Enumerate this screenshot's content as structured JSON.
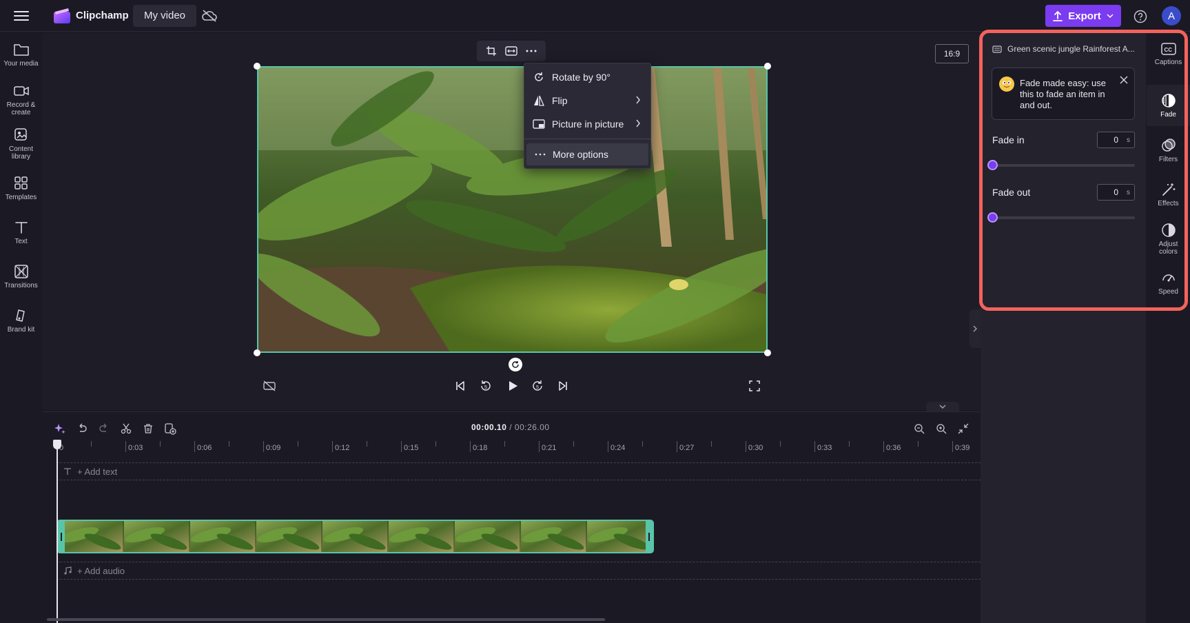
{
  "topbar": {
    "app_name": "Clipchamp",
    "project_title": "My video",
    "export_label": "Export",
    "avatar_initial": "A"
  },
  "sidebar": {
    "items": [
      {
        "label": "Your media",
        "icon": "folder-icon"
      },
      {
        "label": "Record &\ncreate",
        "icon": "camera-icon"
      },
      {
        "label": "Content\nlibrary",
        "icon": "library-icon"
      },
      {
        "label": "Templates",
        "icon": "templates-icon"
      },
      {
        "label": "Text",
        "icon": "text-icon"
      },
      {
        "label": "Transitions",
        "icon": "transitions-icon"
      },
      {
        "label": "Brand kit",
        "icon": "brand-kit-icon"
      }
    ]
  },
  "stage": {
    "aspect_ratio": "16:9"
  },
  "context_menu": {
    "items": [
      {
        "label": "Rotate by 90°",
        "icon": "rotate-icon"
      },
      {
        "label": "Flip",
        "icon": "flip-icon"
      },
      {
        "label": "Picture in picture",
        "icon": "pip-icon"
      },
      {
        "label": "More options",
        "icon": "more-icon"
      }
    ]
  },
  "timeline": {
    "current_time": "00:00.10",
    "separator": " / ",
    "total_time": "00:26.00",
    "ruler_labels": [
      "0",
      "0:03",
      "0:06",
      "0:09",
      "0:12",
      "0:15",
      "0:18",
      "0:21",
      "0:24",
      "0:27",
      "0:30",
      "0:33",
      "0:36",
      "0:39"
    ],
    "add_text_label": "+ Add text",
    "add_audio_label": "+ Add audio"
  },
  "fade_panel": {
    "clip_title": "Green scenic jungle Rainforest A...",
    "tip_text": "Fade made easy: use this to fade an item in and out.",
    "fade_in_label": "Fade in",
    "fade_in_value": "0",
    "fade_out_label": "Fade out",
    "fade_out_value": "0",
    "unit": "s"
  },
  "right_tabs": {
    "items": [
      {
        "label": "Captions",
        "icon": "captions-icon"
      },
      {
        "label": "Fade",
        "icon": "fade-icon"
      },
      {
        "label": "Filters",
        "icon": "filters-icon"
      },
      {
        "label": "Effects",
        "icon": "effects-icon"
      },
      {
        "label": "Adjust\ncolors",
        "icon": "adjust-colors-icon"
      },
      {
        "label": "Speed",
        "icon": "speed-icon"
      }
    ]
  },
  "colors": {
    "accent": "#7b3bf0",
    "selection": "#59c5a8",
    "highlight": "#f4625d",
    "background": "#1b1a24"
  }
}
